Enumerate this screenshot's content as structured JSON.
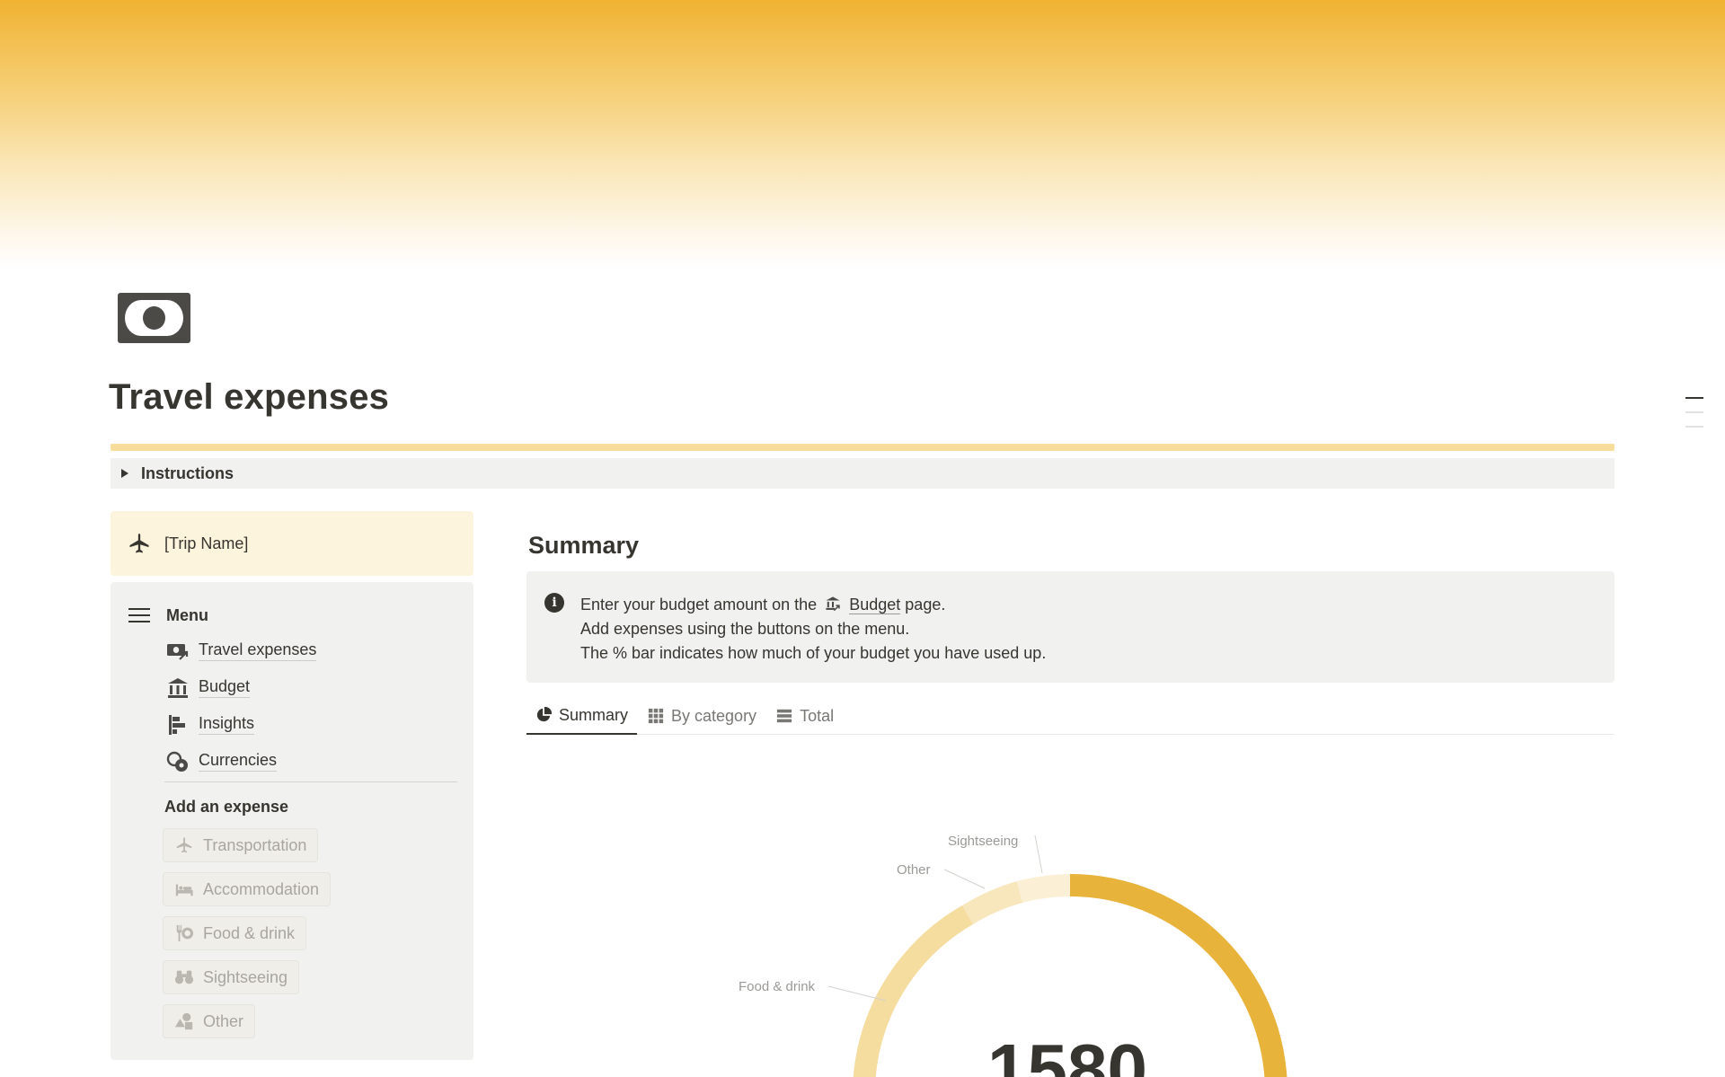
{
  "page": {
    "title": "Travel expenses",
    "accent_color": "#f0b232"
  },
  "instructions": {
    "label": "Instructions"
  },
  "trip": {
    "name": "[Trip Name]",
    "icon": "plane-icon"
  },
  "menu": {
    "title": "Menu",
    "links": [
      {
        "label": "Travel expenses",
        "icon": "money-arrow-icon"
      },
      {
        "label": "Budget",
        "icon": "bank-icon"
      },
      {
        "label": "Insights",
        "icon": "bar-chart-icon"
      },
      {
        "label": "Currencies",
        "icon": "currency-icon"
      }
    ],
    "add_title": "Add an expense",
    "buttons": [
      {
        "label": "Transportation",
        "icon": "plane-icon"
      },
      {
        "label": "Accommodation",
        "icon": "bed-icon"
      },
      {
        "label": "Food & drink",
        "icon": "utensils-icon"
      },
      {
        "label": "Sightseeing",
        "icon": "binoculars-icon"
      },
      {
        "label": "Other",
        "icon": "shapes-icon"
      }
    ]
  },
  "summary": {
    "heading": "Summary",
    "callout": {
      "line1_pre": "Enter your budget amount on the",
      "line1_link": "Budget",
      "line1_post": "page.",
      "line2": "Add expenses using the buttons on the menu.",
      "line3": "The % bar indicates how much of your budget you have used up."
    },
    "tabs": [
      {
        "label": "Summary",
        "icon": "pie-icon",
        "active": true
      },
      {
        "label": "By category",
        "icon": "grid-icon",
        "active": false
      },
      {
        "label": "Total",
        "icon": "list-icon",
        "active": false
      }
    ]
  },
  "chart_data": {
    "type": "pie",
    "labels": [
      "Sightseeing",
      "Other",
      "Food & drink"
    ],
    "center_value_visible": "1580",
    "colors": {
      "primary": "#e8b33a",
      "light": "#f5dc9f",
      "lighter": "#f8e7bd",
      "lightest": "#fbf0d5"
    }
  }
}
